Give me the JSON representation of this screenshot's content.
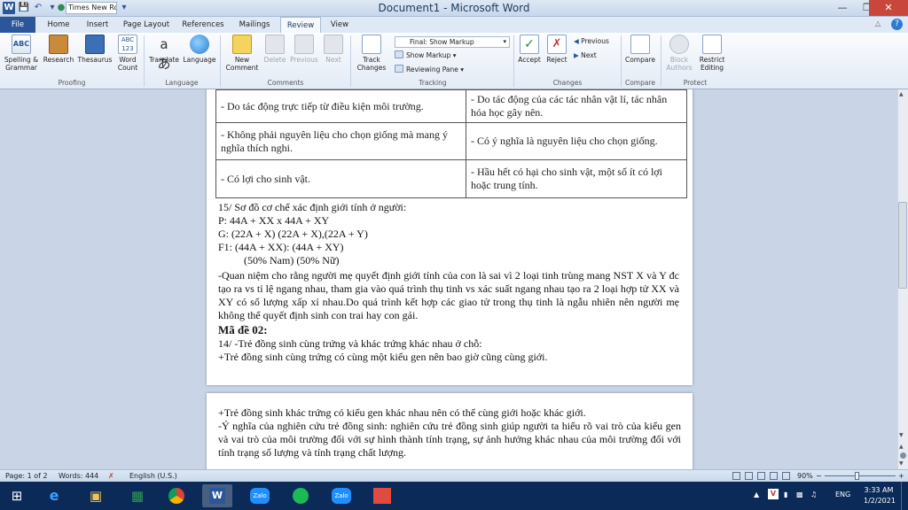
{
  "window": {
    "title": "Document1  -  Microsoft Word",
    "font_box": "Times New Ro",
    "controls": {
      "minimize": "—",
      "restore": "❐",
      "close": "✕"
    }
  },
  "tabs": [
    "File",
    "Home",
    "Insert",
    "Page Layout",
    "References",
    "Mailings",
    "Review",
    "View"
  ],
  "ribbon": {
    "proofing": {
      "label": "Proofing",
      "spelling": "Spelling &",
      "spelling2": "Grammar",
      "research": "Research",
      "thesaurus": "Thesaurus",
      "word_count": "Word",
      "word_count2": "Count"
    },
    "language": {
      "label": "Language",
      "translate": "Translate",
      "language": "Language"
    },
    "comments": {
      "label": "Comments",
      "new": "New",
      "new2": "Comment",
      "delete": "Delete",
      "previous": "Previous",
      "next": "Next"
    },
    "tracking": {
      "label": "Tracking",
      "track": "Track",
      "track2": "Changes",
      "final_dropdown": "Final: Show Markup",
      "show_markup": "Show Markup",
      "reviewing_pane": "Reviewing Pane"
    },
    "changes": {
      "label": "Changes",
      "accept": "Accept",
      "reject": "Reject",
      "previous": "Previous",
      "next": "Next"
    },
    "compare": {
      "label": "Compare",
      "compare": "Compare"
    },
    "protect": {
      "label": "Protect",
      "block": "Block",
      "block2": "Authors",
      "restrict": "Restrict",
      "restrict2": "Editing"
    }
  },
  "document": {
    "table_rows": [
      {
        "left": "- Do tác động trực tiếp từ điều kiện môi trường.",
        "right": "- Do tác động của các tác nhân vật lí, tác nhân hóa học gây nên."
      },
      {
        "left": "- Không phải nguyên liệu cho chọn giống mà mang ý nghĩa thích nghi.",
        "right": "- Có ý nghĩa là nguyên liệu cho chọn giống."
      },
      {
        "left": "- Có lợi cho sinh vật.",
        "right": "- Hầu hết có hại cho sinh vật, một số ít có lợi hoặc trung tính."
      }
    ],
    "q15_title": "15/ Sơ đồ cơ chế xác định giới tính ở người:",
    "p_line": "P:  44A + XX  x 44A + XY",
    "g_line": "G:  (22A + X)  (22A + X),(22A + Y)",
    "f1_line": "F1:   (44A + XX): (44A + XY)",
    "ratio_line": "(50% Nam)    (50% Nữ)",
    "para1": "-Quan niệm cho rằng người mẹ quyết định giới tính của con là sai vì 2 loại tinh trùng mang NST X và Y đc tạo ra vs tỉ lệ ngang nhau, tham gia vào quá trình thụ tinh vs xác suất ngang nhau tạo ra 2 loại hợp tử XX và XY có số lượng xấp xỉ nhau.Do quá trình kết hợp các giao tử trong thụ tinh là ngẫu nhiên nên người mẹ không thể quyết định sinh con trai hay con gái.",
    "heading2": "Mã đề 02:",
    "q14": "14/ -Trẻ đồng sinh cùng trứng và khác trứng khác nhau ở chỗ:",
    "q14_line2": "+Trẻ đồng sinh cùng trứng có cùng một kiểu gen nên bao giờ cũng cùng giới.",
    "p2_line1": "+Trẻ đồng sinh khác trứng có kiểu gen khác nhau nên có thể cùng giới hoặc khác giới.",
    "p2_para": "-Ý nghĩa của nghiên cứu trẻ đồng sinh: nghiên cứu trẻ đồng sinh giúp người ta hiểu rõ vai trò của kiểu gen và vai trò của môi trường đối với sự hình thành tính trạng, sự ảnh hưởng khác nhau của môi trường đối với tính trạng số lượng và tính trạng chất lượng."
  },
  "status": {
    "page": "Page: 1 of 2",
    "words": "Words: 444",
    "language": "English (U.S.)",
    "zoom": "90%"
  },
  "taskbar": {
    "lang": "ENG",
    "time": "3:33 AM",
    "date": "1/2/2021",
    "zalo": "Zalo"
  }
}
